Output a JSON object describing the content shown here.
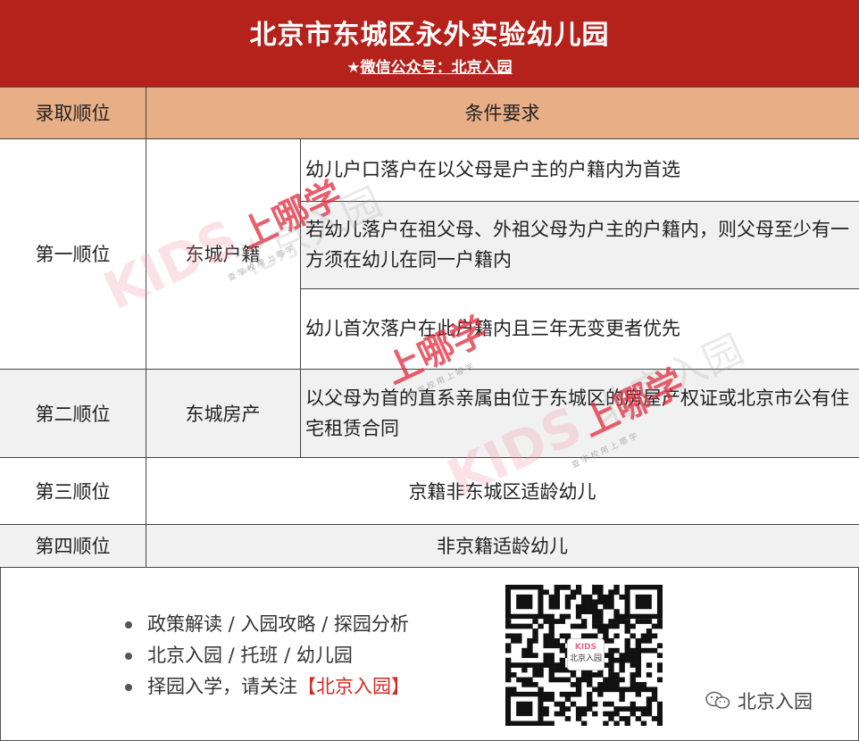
{
  "banner": {
    "title": "北京市东城区永外实验幼儿园",
    "subtitle_star": "★",
    "subtitle": "微信公众号：北京入园"
  },
  "table": {
    "headers": {
      "order": "录取顺位",
      "conditions": "条件要求"
    },
    "rows": {
      "first": {
        "order": "第一顺位",
        "category": "东城户籍",
        "conditions": [
          "幼儿户口落户在以父母是户主的户籍内为首选",
          "若幼儿落户在祖父母、外祖父母为户主的户籍内，则父母至少有一方须在幼儿在同一户籍内",
          "幼儿首次落户在此户籍内且三年无变更者优先"
        ]
      },
      "second": {
        "order": "第二顺位",
        "category": "东城房产",
        "condition": "以父母为首的直系亲属由位于东城区的房屋产权证或北京市公有住宅租赁合同"
      },
      "third": {
        "order": "第三顺位",
        "condition": "京籍非东城区适龄幼儿"
      },
      "fourth": {
        "order": "第四顺位",
        "condition": "非京籍适龄幼儿"
      }
    }
  },
  "footer": {
    "items": [
      "政策解读 / 入园攻略 / 探园分析",
      "北京入园 / 托班 / 幼儿园"
    ],
    "item3_prefix": "择园入学，请关注",
    "item3_highlight": "【北京入园】",
    "qr_center": {
      "line1": "KIDS",
      "line2": "北京入园"
    },
    "wechat_label": "北京入园"
  },
  "watermark": {
    "brand": "上哪学",
    "latin": "KIDS",
    "slogan": "查 学 校   用 上 哪 学",
    "name": "北京入园"
  },
  "colors": {
    "banner": "#b5221c",
    "header_row": "#e8ae86",
    "gray_row": "#f1f1f1",
    "highlight": "#d22a22"
  }
}
